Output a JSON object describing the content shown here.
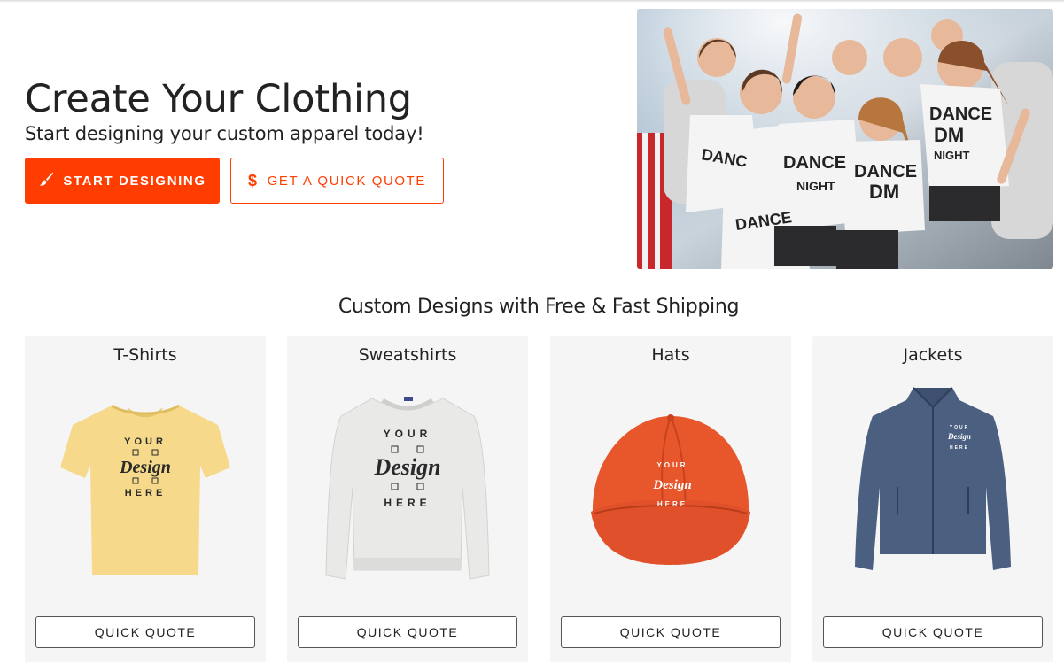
{
  "hero": {
    "title": "Create Your Clothing",
    "subtitle": "Start designing your custom apparel today!",
    "primary_button": "START DESIGNING",
    "secondary_button": "GET A QUICK QUOTE",
    "photo_shirt_text": "DANCE DM NIGHT"
  },
  "section": {
    "title": "Custom Designs with Free & Fast Shipping"
  },
  "products": [
    {
      "title": "T-Shirts",
      "button": "QUICK QUOTE",
      "color": "#f6d98a"
    },
    {
      "title": "Sweatshirts",
      "button": "QUICK QUOTE",
      "color": "#e9e9e7"
    },
    {
      "title": "Hats",
      "button": "QUICK QUOTE",
      "color": "#e8562c"
    },
    {
      "title": "Jackets",
      "button": "QUICK QUOTE",
      "color": "#4b5f80"
    }
  ],
  "design_mark": {
    "top": "YOUR",
    "middle": "Design",
    "bottom": "HERE"
  },
  "colors": {
    "accent": "#ff3d00",
    "card_bg": "#f5f5f5"
  }
}
